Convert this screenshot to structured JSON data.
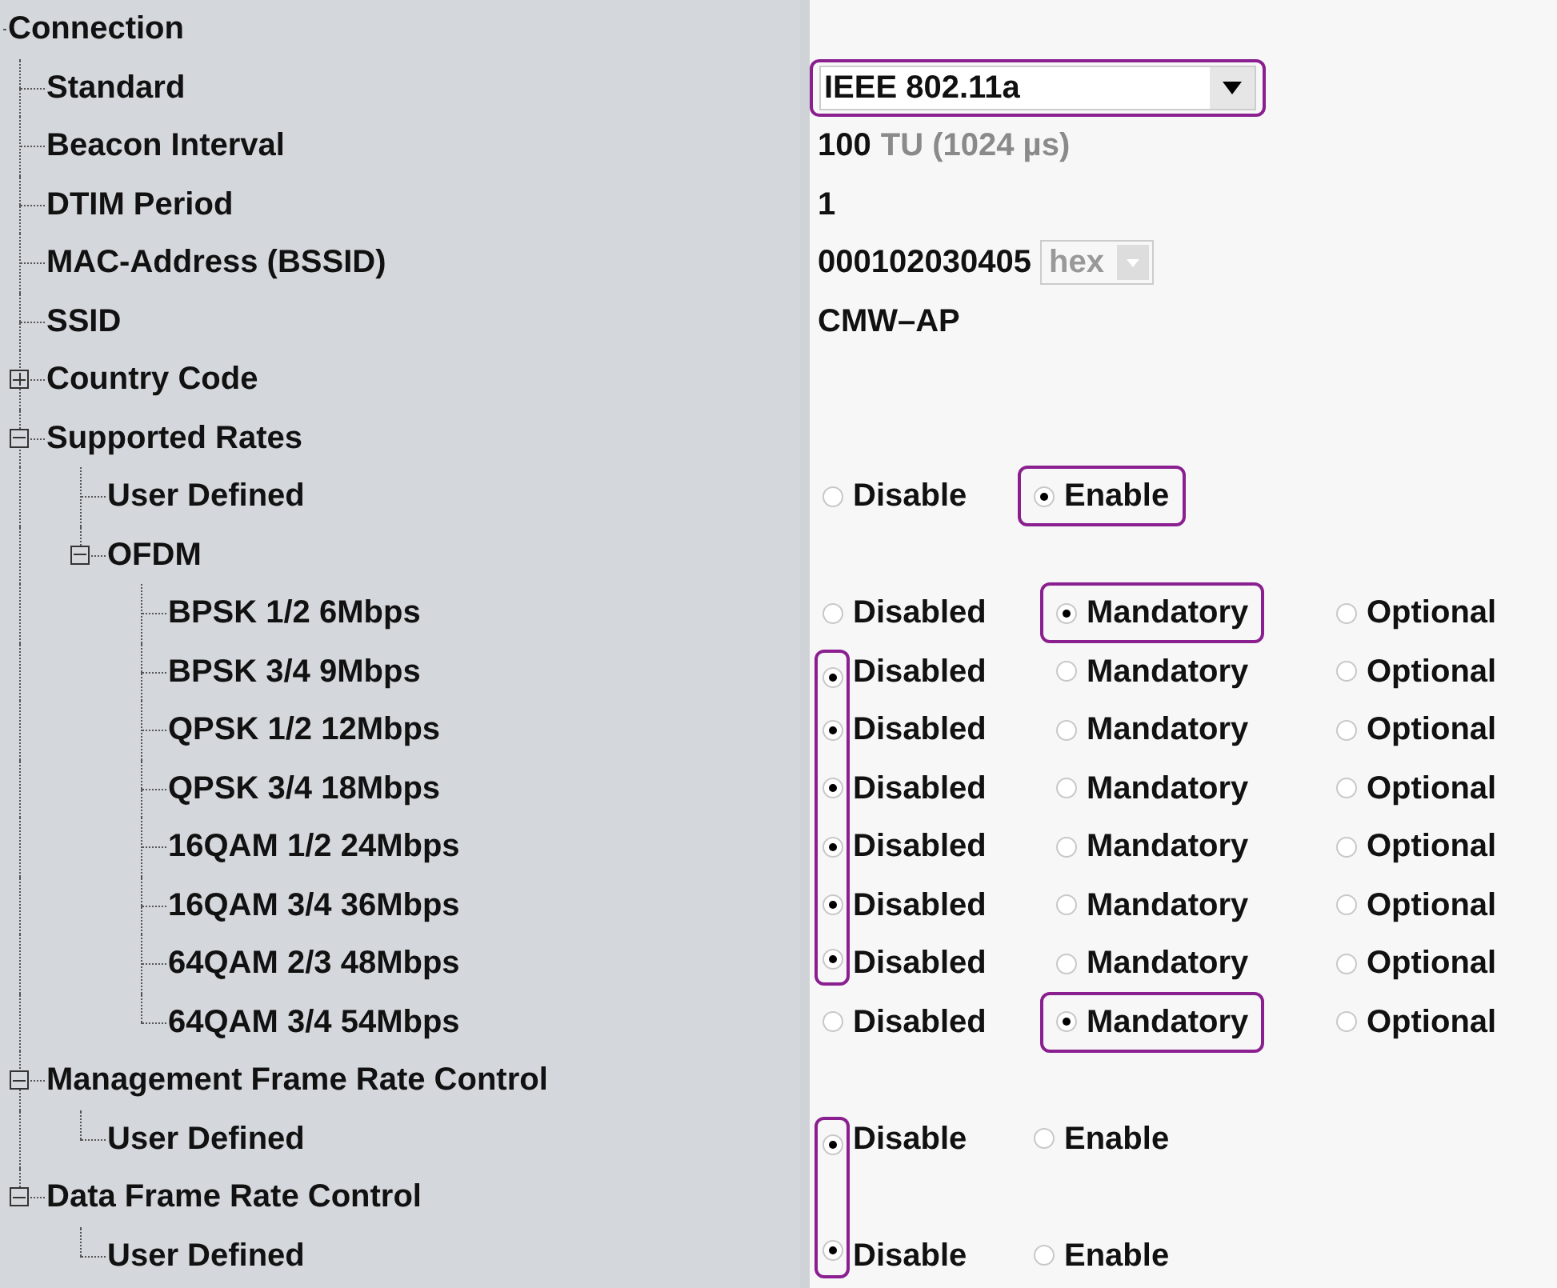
{
  "tree": {
    "label": "Connection",
    "children": [
      {
        "label": "Standard",
        "value": {
          "kind": "select",
          "text": "IEEE 802.11a",
          "highlighted": true
        }
      },
      {
        "label": "Beacon Interval",
        "value": {
          "kind": "reading",
          "text": "100",
          "unit": "TU (1024 µs)"
        }
      },
      {
        "label": "DTIM Period",
        "value": {
          "kind": "reading",
          "text": "1"
        }
      },
      {
        "label": "MAC-Address (BSSID)",
        "value": {
          "kind": "address",
          "text": "000102030405",
          "format": "hex",
          "format_disabled": true
        }
      },
      {
        "label": "SSID",
        "value": {
          "kind": "reading",
          "text": "CMW–AP"
        }
      },
      {
        "label": "Country Code",
        "expanded": false
      },
      {
        "label": "Supported Rates",
        "expanded": true,
        "children": [
          {
            "label": "User Defined",
            "value": {
              "kind": "radio",
              "options": [
                {
                  "label": "Disable",
                  "selected": false,
                  "highlighted": false
                },
                {
                  "label": "Enable",
                  "selected": true,
                  "highlighted": true
                }
              ]
            }
          },
          {
            "label": "OFDM",
            "expanded": true,
            "children": [
              {
                "label": "BPSK 1/2 6Mbps",
                "value": {
                  "kind": "radio",
                  "options": [
                    {
                      "label": "Disabled",
                      "selected": false,
                      "highlighted": false
                    },
                    {
                      "label": "Mandatory",
                      "selected": true,
                      "highlighted": true
                    },
                    {
                      "label": "Optional",
                      "selected": false,
                      "highlighted": false
                    }
                  ]
                }
              },
              {
                "label": "BPSK 3/4 9Mbps",
                "value": {
                  "kind": "radio",
                  "options": [
                    {
                      "label": "Disabled",
                      "selected": true,
                      "highlighted": true
                    },
                    {
                      "label": "Mandatory",
                      "selected": false,
                      "highlighted": false
                    },
                    {
                      "label": "Optional",
                      "selected": false,
                      "highlighted": false
                    }
                  ]
                }
              },
              {
                "label": "QPSK 1/2 12Mbps",
                "value": {
                  "kind": "radio",
                  "options": [
                    {
                      "label": "Disabled",
                      "selected": true,
                      "highlighted": true
                    },
                    {
                      "label": "Mandatory",
                      "selected": false,
                      "highlighted": false
                    },
                    {
                      "label": "Optional",
                      "selected": false,
                      "highlighted": false
                    }
                  ]
                }
              },
              {
                "label": "QPSK 3/4 18Mbps",
                "value": {
                  "kind": "radio",
                  "options": [
                    {
                      "label": "Disabled",
                      "selected": true,
                      "highlighted": true
                    },
                    {
                      "label": "Mandatory",
                      "selected": false,
                      "highlighted": false
                    },
                    {
                      "label": "Optional",
                      "selected": false,
                      "highlighted": false
                    }
                  ]
                }
              },
              {
                "label": "16QAM 1/2 24Mbps",
                "value": {
                  "kind": "radio",
                  "options": [
                    {
                      "label": "Disabled",
                      "selected": true,
                      "highlighted": true
                    },
                    {
                      "label": "Mandatory",
                      "selected": false,
                      "highlighted": false
                    },
                    {
                      "label": "Optional",
                      "selected": false,
                      "highlighted": false
                    }
                  ]
                }
              },
              {
                "label": "16QAM 3/4 36Mbps",
                "value": {
                  "kind": "radio",
                  "options": [
                    {
                      "label": "Disabled",
                      "selected": true,
                      "highlighted": true
                    },
                    {
                      "label": "Mandatory",
                      "selected": false,
                      "highlighted": false
                    },
                    {
                      "label": "Optional",
                      "selected": false,
                      "highlighted": false
                    }
                  ]
                }
              },
              {
                "label": "64QAM 2/3 48Mbps",
                "value": {
                  "kind": "radio",
                  "options": [
                    {
                      "label": "Disabled",
                      "selected": true,
                      "highlighted": true
                    },
                    {
                      "label": "Mandatory",
                      "selected": false,
                      "highlighted": false
                    },
                    {
                      "label": "Optional",
                      "selected": false,
                      "highlighted": false
                    }
                  ]
                }
              },
              {
                "label": "64QAM 3/4 54Mbps",
                "value": {
                  "kind": "radio",
                  "options": [
                    {
                      "label": "Disabled",
                      "selected": false,
                      "highlighted": false
                    },
                    {
                      "label": "Mandatory",
                      "selected": true,
                      "highlighted": true
                    },
                    {
                      "label": "Optional",
                      "selected": false,
                      "highlighted": false
                    }
                  ]
                }
              }
            ]
          }
        ]
      },
      {
        "label": "Management Frame Rate Control",
        "expanded": true,
        "children": [
          {
            "label": "User Defined",
            "value": {
              "kind": "radio",
              "options": [
                {
                  "label": "Disable",
                  "selected": true,
                  "highlighted": true
                },
                {
                  "label": "Enable",
                  "selected": false,
                  "highlighted": false
                }
              ]
            }
          }
        ]
      },
      {
        "label": "Data Frame Rate Control",
        "expanded": true,
        "children": [
          {
            "label": "User Defined",
            "value": {
              "kind": "radio",
              "options": [
                {
                  "label": "Disable",
                  "selected": true,
                  "highlighted": true
                },
                {
                  "label": "Enable",
                  "selected": false,
                  "highlighted": false
                }
              ]
            }
          }
        ]
      }
    ]
  }
}
